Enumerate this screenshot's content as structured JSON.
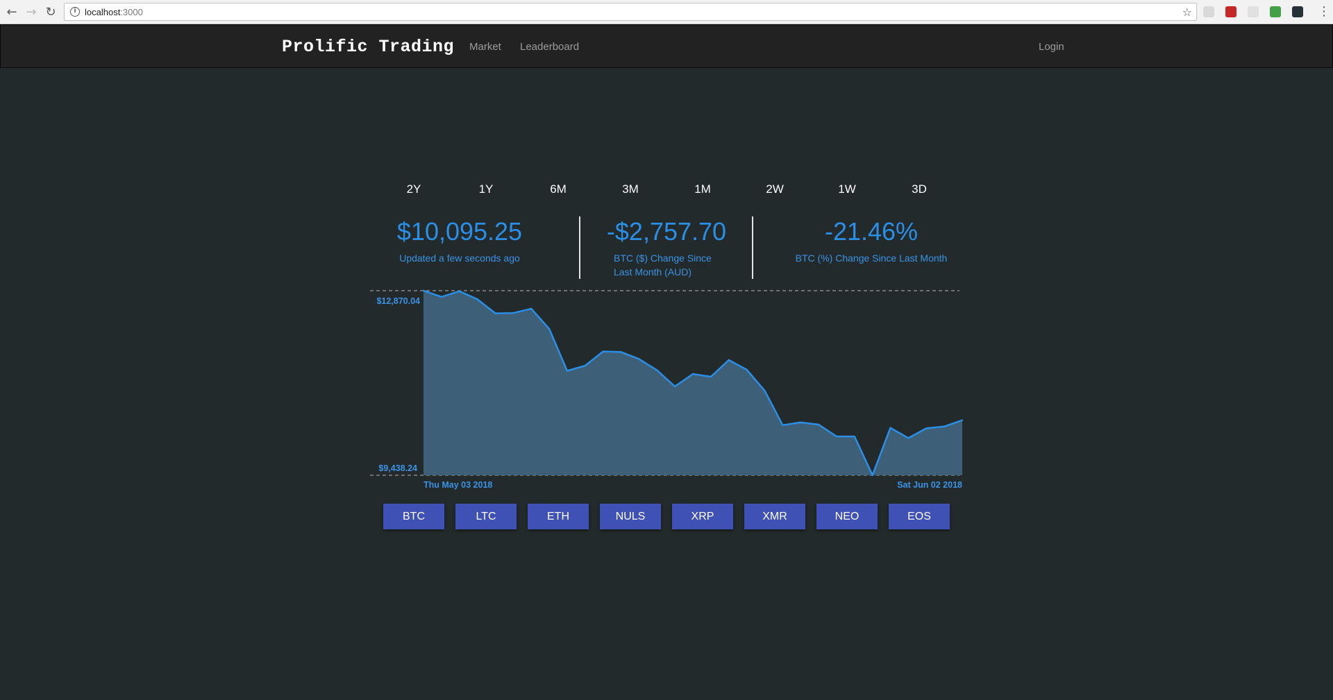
{
  "browser": {
    "url_host": "localhost",
    "url_port": ":3000"
  },
  "app": {
    "brand": "Prolific Trading",
    "nav": {
      "market": "Market",
      "leaderboard": "Leaderboard",
      "login": "Login"
    }
  },
  "periods": [
    "2Y",
    "1Y",
    "6M",
    "3M",
    "1M",
    "2W",
    "1W",
    "3D"
  ],
  "stats": {
    "price": "$10,095.25",
    "price_label": "Updated a few seconds ago",
    "change_abs": "-$2,757.70",
    "change_abs_label_1": "BTC ($) Change Since",
    "change_abs_label_2": "Last Month (AUD)",
    "change_pct": "-21.46%",
    "change_pct_label": "BTC (%) Change Since Last Month"
  },
  "coins": [
    "BTC",
    "LTC",
    "ETH",
    "NULS",
    "XRP",
    "XMR",
    "NEO",
    "EOS"
  ],
  "colors": {
    "accent": "#2b8fe6",
    "area_fill": "#3e5f78",
    "button": "#3f51b5",
    "background": "#232a2b"
  },
  "chart_data": {
    "type": "area",
    "max_label": "$12,870.04",
    "min_label": "$9,438.24",
    "start_label": "Thu May 03 2018",
    "end_label": "Sat Jun 02 2018",
    "ylim": [
      9438.24,
      12870.04
    ],
    "values": [
      12870.04,
      12755,
      12860,
      12710,
      12450,
      12455,
      12535,
      12160,
      11380,
      11475,
      11740,
      11730,
      11600,
      11390,
      11090,
      11320,
      11270,
      11580,
      11400,
      11010,
      10370,
      10420,
      10380,
      10160,
      10160,
      9438.24,
      10320,
      10130,
      10310,
      10345,
      10460
    ]
  }
}
